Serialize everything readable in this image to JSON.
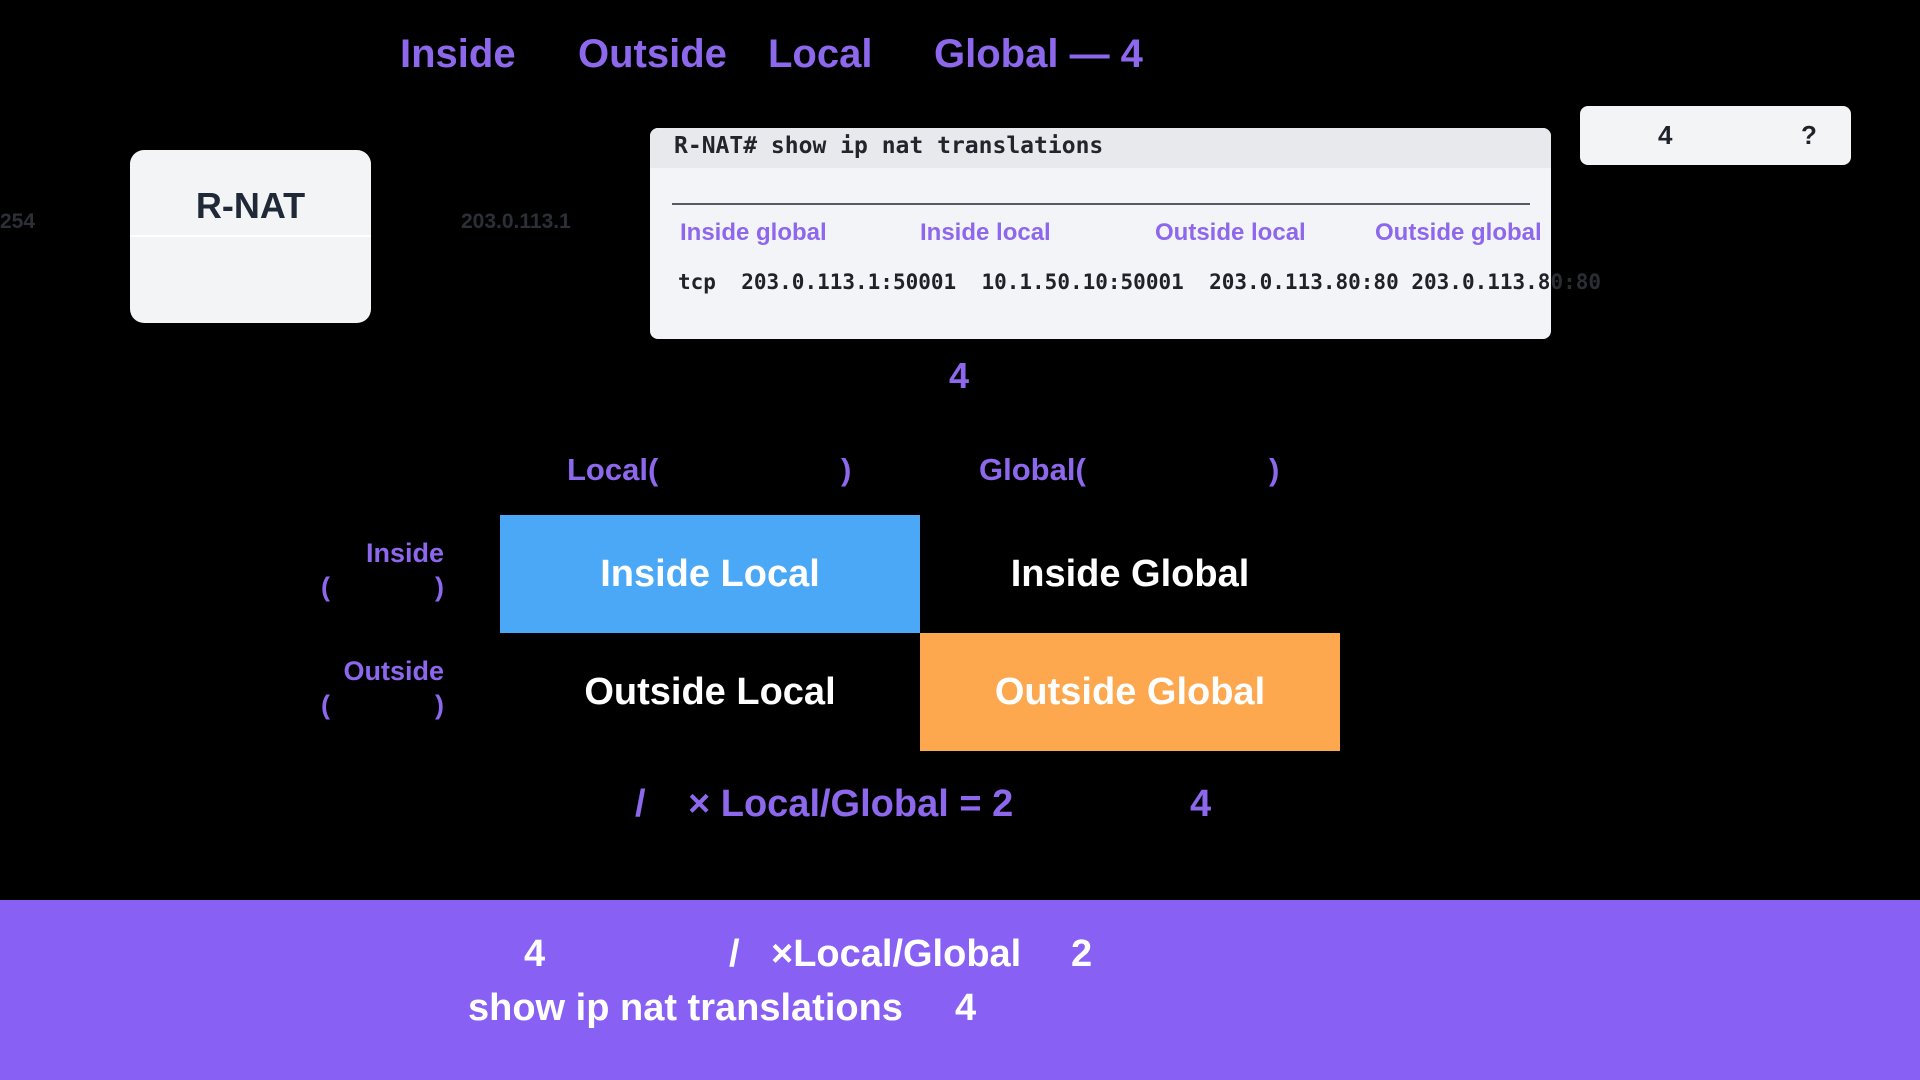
{
  "title": {
    "inside": "Inside",
    "outside": "Outside",
    "local": "Local",
    "global": "Global — 4"
  },
  "router": {
    "name": "R-NAT",
    "left_ip_partial": "254",
    "right_ip": "203.0.113.1"
  },
  "terminal": {
    "command": "R-NAT# show ip nat translations",
    "columns": [
      "Inside global",
      "Inside local",
      "Outside local",
      "Outside global"
    ],
    "row": {
      "proto": "tcp",
      "inside_global": "203.0.113.1:50001",
      "inside_local": "10.1.50.10:50001",
      "outside_local": "203.0.113.80:80",
      "outside_global_main": "203.0.113.8",
      "outside_global_tail": "0:80"
    }
  },
  "pill": {
    "left": "4",
    "right": "?"
  },
  "caption_count": "4",
  "matrix": {
    "col_local": "Local(",
    "col_local_close": ")",
    "col_global": "Global(",
    "col_global_close": ")",
    "row_inside": "Inside",
    "row_inside_paren_open": "(",
    "row_inside_paren_close": ")",
    "row_outside": "Outside",
    "row_outside_paren_open": "(",
    "row_outside_paren_close": ")",
    "cells": {
      "inside_local": "Inside Local",
      "inside_global": "Inside Global",
      "outside_local": "Outside Local",
      "outside_global": "Outside Global"
    }
  },
  "formula": {
    "slash": "/",
    "expr": "× Local/Global = 2",
    "result": "4"
  },
  "footer": {
    "line1_num": "4",
    "line1_slash": "/",
    "line1_expr": "×Local/Global",
    "line1_two": "2",
    "line2_cmd": "show ip nat translations",
    "line2_num": "4"
  },
  "colors": {
    "accent_purple": "#8d67ec",
    "inside_local_blue": "#4aa8f6",
    "outside_global_orange": "#fda84f",
    "footer_bg": "#8860f3"
  }
}
